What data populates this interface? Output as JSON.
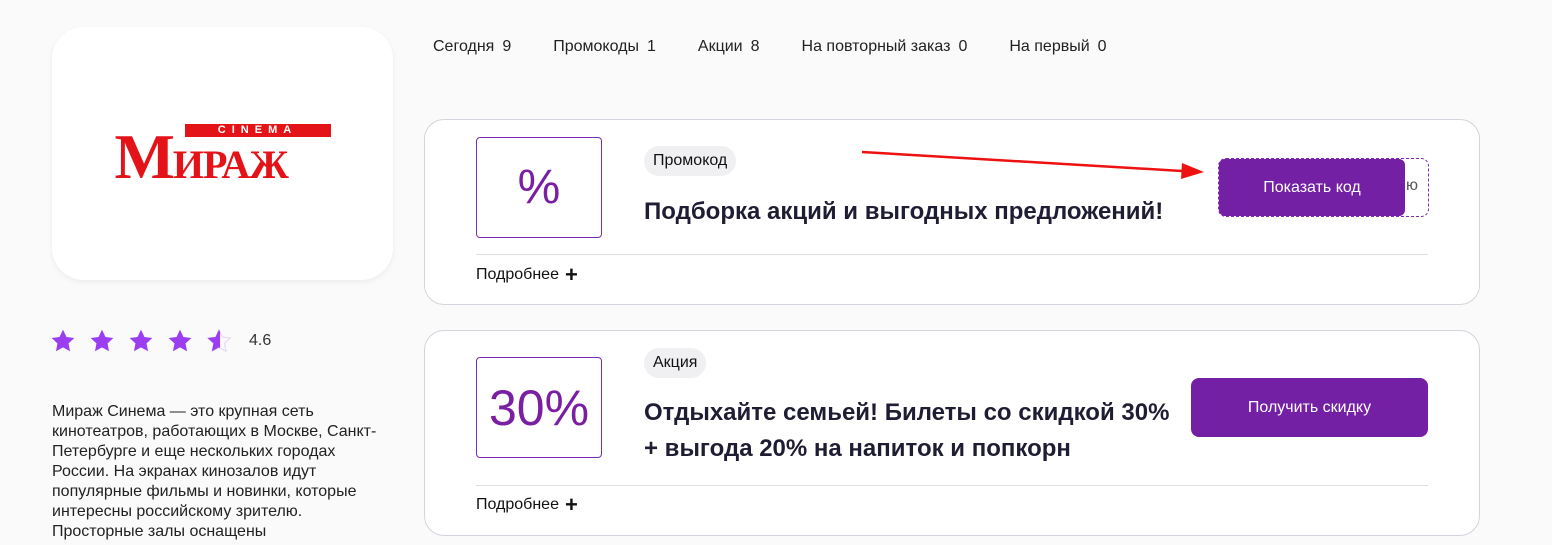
{
  "store": {
    "logo_text_main": "МИРАЖ",
    "logo_text_small": "CINEMA",
    "rating": "4.6",
    "rating_stars": 4.6,
    "description": "Мираж Синема — это крупная сеть кинотеатров, работающих в Москве, Санкт-Петербурге и еще нескольких городах России. На экранах кинозалов идут популярные фильмы и новинки, которые интересны российскому зрителю. Просторные залы оснащены"
  },
  "tabs": [
    {
      "label": "Сегодня",
      "count": "9"
    },
    {
      "label": "Промокоды",
      "count": "1"
    },
    {
      "label": "Акции",
      "count": "8"
    },
    {
      "label": "На повторный заказ",
      "count": "0"
    },
    {
      "label": "На первый",
      "count": "0"
    }
  ],
  "offers": [
    {
      "badge": "%",
      "tag": "Промокод",
      "title": "Подборка акций и выгодных предложений!",
      "code_peek": "ю",
      "button": "Показать код",
      "more": "Подробнее"
    },
    {
      "badge": "30%",
      "tag": "Акция",
      "title": "Отдыхайте семьей! Билеты со скидкой 30% + выгода 20% на напиток и попкорн",
      "button": "Получить скидку",
      "more": "Подробнее"
    }
  ],
  "colors": {
    "accent": "#7420a4",
    "star": "#9b3df0",
    "logo_red": "#e31318",
    "annotation_arrow": "#ee1111"
  }
}
